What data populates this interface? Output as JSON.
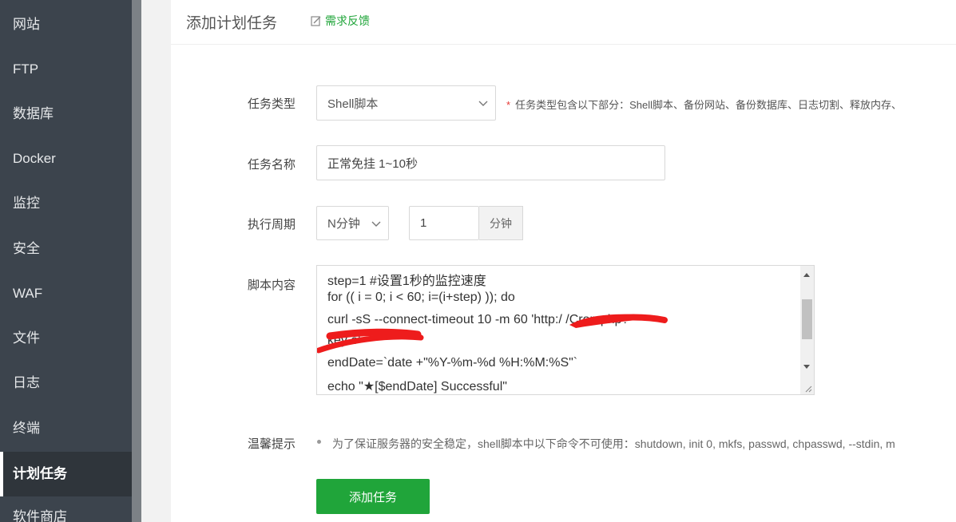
{
  "sidebar": {
    "items": [
      {
        "label": "网站"
      },
      {
        "label": "FTP"
      },
      {
        "label": "数据库"
      },
      {
        "label": "Docker"
      },
      {
        "label": "监控"
      },
      {
        "label": "安全"
      },
      {
        "label": "WAF"
      },
      {
        "label": "文件"
      },
      {
        "label": "日志"
      },
      {
        "label": "终端"
      },
      {
        "label": "计划任务",
        "active": true
      },
      {
        "label": "软件商店"
      }
    ]
  },
  "header": {
    "title": "添加计划任务",
    "feedback": "需求反馈"
  },
  "form": {
    "task_type": {
      "label": "任务类型",
      "value": "Shell脚本",
      "hint_star": "*",
      "hint": "任务类型包含以下部分：Shell脚本、备份网站、备份数据库、日志切割、释放内存、"
    },
    "task_name": {
      "label": "任务名称",
      "value": "正常免挂 1~10秒"
    },
    "period": {
      "label": "执行周期",
      "mode": "N分钟",
      "value": "1",
      "unit": "分钟"
    },
    "script": {
      "label": "脚本内容",
      "lines": [
        "step=1 #设置1秒的监控速度",
        "for (( i = 0; i < 60; i=(i+step) )); do",
        "curl -sS --connect-timeout 10 -m 60 'http:/          /Cron.php?",
        "key          e'",
        "endDate=`date +\"%Y-%m-%d %H:%M:%S\"`",
        "echo \"★[$endDate] Successful\""
      ]
    },
    "tips": {
      "label": "温馨提示",
      "text": "为了保证服务器的安全稳定，shell脚本中以下命令不可使用：shutdown, init 0, mkfs, passwd, chpasswd, --stdin, m"
    },
    "submit_label": "添加任务"
  },
  "colors": {
    "sidebar_bg": "#3c444d",
    "accent": "#20a53a",
    "required": "#e53935",
    "redaction": "#ee1c1c"
  }
}
